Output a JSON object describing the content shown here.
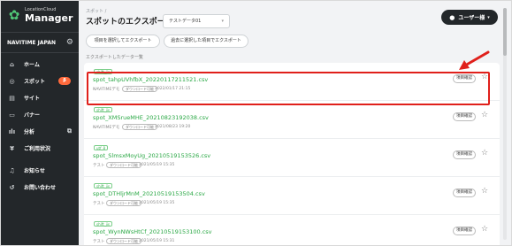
{
  "app": {
    "logo_small": "LocationCloud",
    "logo_big": "Manager",
    "company": "NAVITIME JAPAN"
  },
  "sidebar": {
    "items": [
      {
        "label": "ホーム",
        "icon": "home-icon",
        "glyph": "⌂"
      },
      {
        "label": "スポット",
        "icon": "spot-icon",
        "glyph": "◎",
        "badge": "β"
      },
      {
        "label": "サイト",
        "icon": "site-icon",
        "glyph": "▤"
      },
      {
        "label": "バナー",
        "icon": "banner-icon",
        "glyph": "▭"
      },
      {
        "label": "分析",
        "icon": "analytics-icon",
        "glyph": "ılı",
        "ext": "⧉"
      },
      {
        "label": "ご利用状況",
        "icon": "usage-icon",
        "glyph": "¥"
      },
      {
        "label": "お知らせ",
        "icon": "bell-icon",
        "glyph": "♫"
      },
      {
        "label": "お問い合わせ",
        "icon": "contact-icon",
        "glyph": "↺"
      }
    ]
  },
  "header": {
    "breadcrumb": "スポット /",
    "title": "スポットのエクスポート",
    "dataset_selected": "テストデータ01",
    "user_label": "ユーザー様",
    "select_items_button": "項目を選択してエクスポート",
    "past_items_button": "過去に選択した項目でエクスポート"
  },
  "section_label": "エクスポートしたデータ一覧",
  "exports": [
    {
      "tag": "shift_jis",
      "filename": "spot_tahpUVhfbX_20220117211521.csv",
      "owner": "NAVITIMEデモ",
      "download": "ダウンロード可能",
      "date": "2022/01/17 21:15",
      "confirm": "項目確認",
      "highlighted": true
    },
    {
      "tag": "shift_jis",
      "filename": "spot_XMSrueMHE_20210823192038.csv",
      "owner": "NAVITIMEデモ",
      "download": "ダウンロード可能",
      "date": "2021/08/23 19:20",
      "confirm": "項目確認"
    },
    {
      "tag": "utf_8",
      "filename": "spot_SlmsxMoyUg_20210519153526.csv",
      "owner": "テスト",
      "download": "ダウンロード可能",
      "date": "2021/05/19 15:35",
      "confirm": "項目確認"
    },
    {
      "tag": "shift_jis",
      "filename": "spot_DTHljrMnM_20210519153504.csv",
      "owner": "テスト",
      "download": "ダウンロード可能",
      "date": "2021/05/19 15:35",
      "confirm": "項目確認"
    },
    {
      "tag": "shift_jis",
      "filename": "spot_WynNWsHtCf_20210519153100.csv",
      "owner": "テスト",
      "download": "ダウンロード可能",
      "date": "2021/05/19 15:31",
      "confirm": "項目確認"
    }
  ],
  "colors": {
    "sidebar_bg": "#23272a",
    "accent_green": "#2aa845",
    "badge_orange": "#ff6a3c",
    "highlight_red": "#e0201b"
  }
}
